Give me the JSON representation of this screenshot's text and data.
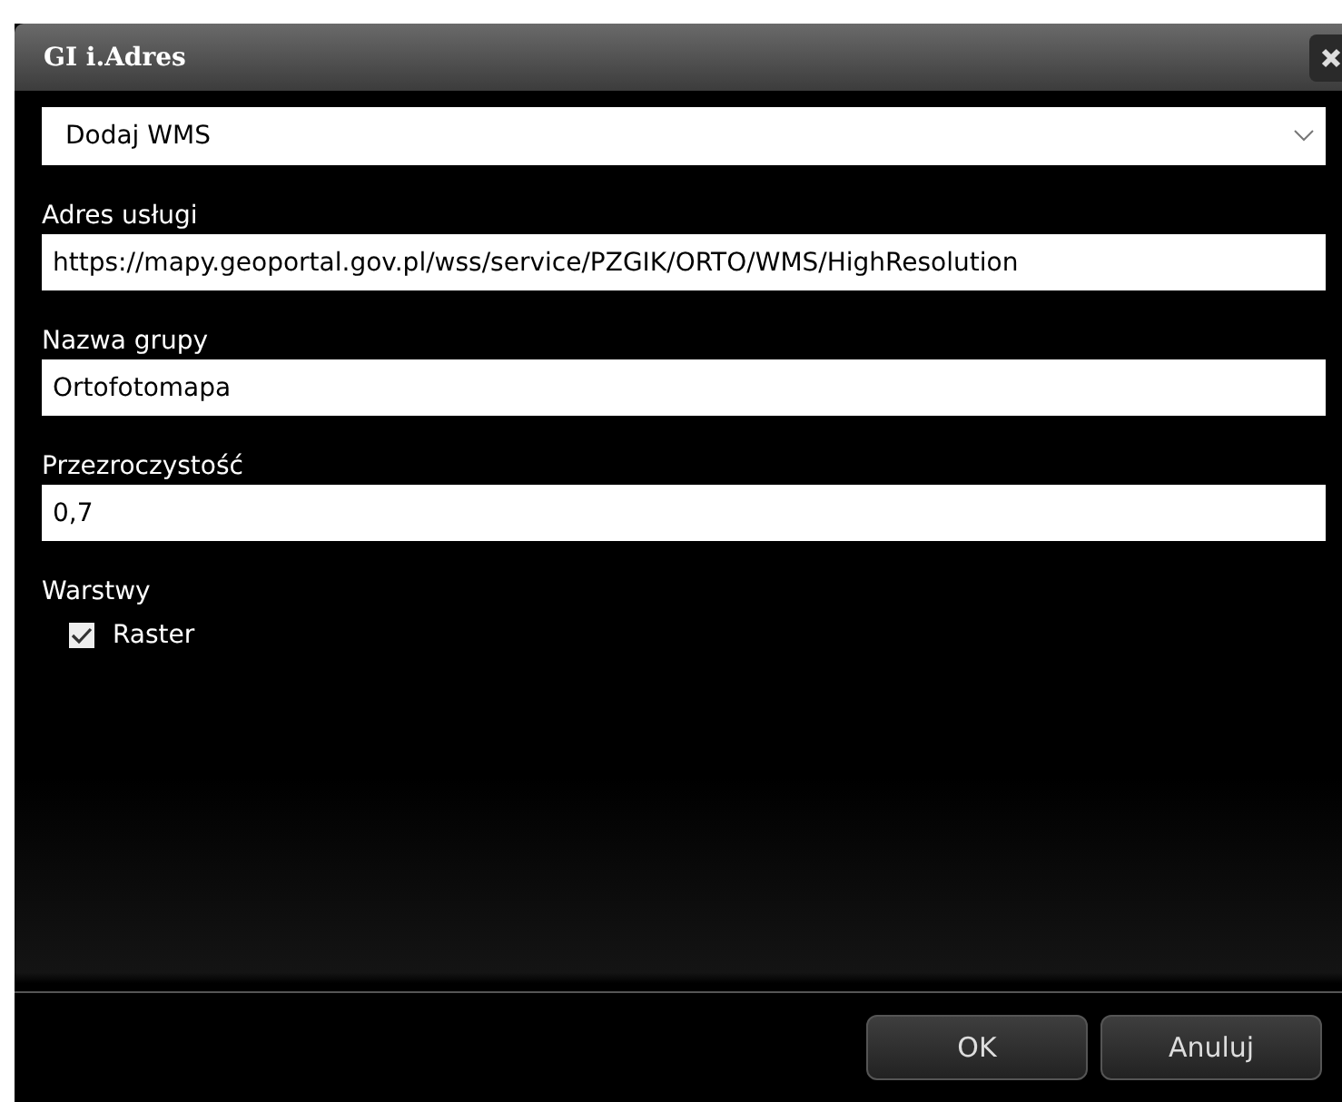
{
  "window": {
    "title": "GI i.Adres"
  },
  "select": {
    "value": "Dodaj WMS"
  },
  "fields": [
    {
      "label": "Adres usługi",
      "value": "https://mapy.geoportal.gov.pl/wss/service/PZGIK/ORTO/WMS/HighResolution"
    },
    {
      "label": "Nazwa grupy",
      "value": "Ortofotomapa"
    },
    {
      "label": "Przezroczystość",
      "value": "0,7"
    }
  ],
  "layers": {
    "label": "Warstwy",
    "items": [
      {
        "label": "Raster",
        "checked": true
      }
    ]
  },
  "buttons": [
    "OK",
    "Anuluj"
  ]
}
